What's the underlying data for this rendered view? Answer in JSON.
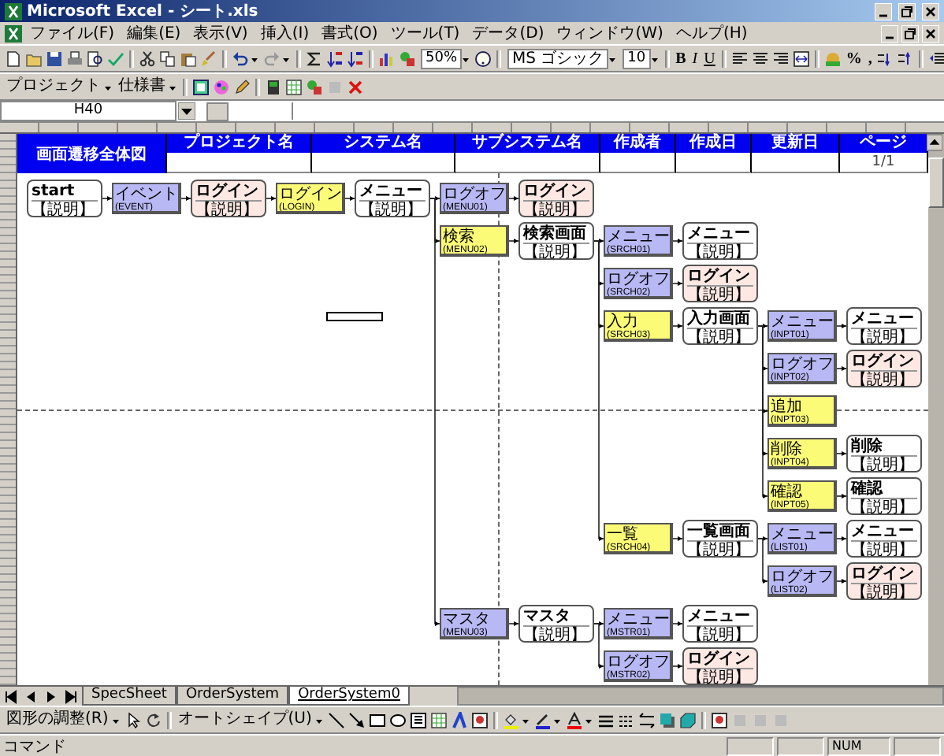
{
  "window": {
    "title": "Microsoft Excel - シート.xls"
  },
  "menu": [
    "ファイル(F)",
    "編集(E)",
    "表示(V)",
    "挿入(I)",
    "書式(O)",
    "ツール(T)",
    "データ(D)",
    "ウィンドウ(W)",
    "ヘルプ(H)"
  ],
  "standard_toolbar": {
    "zoom": "50%"
  },
  "formatting_toolbar": {
    "font": "MS ゴシック",
    "size": "10",
    "style_buttons": [
      "B",
      "I",
      "U"
    ],
    "number_buttons": [
      "%",
      ","
    ]
  },
  "custom_toolbar": {
    "menus": [
      "プロジェクト",
      "仕様書"
    ]
  },
  "formula_bar": {
    "name_box": "H40"
  },
  "sheet_header": {
    "title": "画面遷移全体図",
    "fields": [
      {
        "label": "プロジェクト名"
      },
      {
        "label": "システム名"
      },
      {
        "label": "サブシステム名"
      },
      {
        "label": "作成者"
      },
      {
        "label": "作成日"
      },
      {
        "label": "更新日"
      },
      {
        "label": "ページ",
        "value": "1/1"
      }
    ]
  },
  "flow": {
    "root": {
      "kind": "screen",
      "title": "start",
      "note": "【説明】",
      "children": [
        {
          "kind": "event",
          "label": "イベント",
          "code": "(EVENT)",
          "children": [
            {
              "kind": "login",
              "title": "ログイン",
              "note": "【説明】",
              "children": [
                {
                  "kind": "condition",
                  "label": "ログイン",
                  "code": "(LOGIN)",
                  "children": [
                    {
                      "kind": "screen",
                      "title": "メニュー",
                      "note": "【説明】",
                      "children": [
                        {
                          "kind": "event",
                          "label": "ログオフ",
                          "code": "(MENU01)",
                          "children": [
                            {
                              "kind": "login",
                              "title": "ログイン",
                              "note": "【説明】"
                            }
                          ]
                        },
                        {
                          "kind": "condition",
                          "label": "検索",
                          "code": "(MENU02)",
                          "children": [
                            {
                              "kind": "screen",
                              "title": "検索画面",
                              "note": "【説明】",
                              "children": [
                                {
                                  "kind": "event",
                                  "label": "メニュー",
                                  "code": "(SRCH01)",
                                  "children": [
                                    {
                                      "kind": "screen",
                                      "title": "メニュー",
                                      "note": "【説明】"
                                    }
                                  ]
                                },
                                {
                                  "kind": "event",
                                  "label": "ログオフ",
                                  "code": "(SRCH02)",
                                  "children": [
                                    {
                                      "kind": "login",
                                      "title": "ログイン",
                                      "note": "【説明】"
                                    }
                                  ]
                                },
                                {
                                  "kind": "condition",
                                  "label": "入力",
                                  "code": "(SRCH03)",
                                  "children": [
                                    {
                                      "kind": "screen",
                                      "title": "入力画面",
                                      "note": "【説明】",
                                      "children": [
                                        {
                                          "kind": "event",
                                          "label": "メニュー",
                                          "code": "(INPT01)",
                                          "children": [
                                            {
                                              "kind": "screen",
                                              "title": "メニュー",
                                              "note": "【説明】"
                                            }
                                          ]
                                        },
                                        {
                                          "kind": "event",
                                          "label": "ログオフ",
                                          "code": "(INPT02)",
                                          "children": [
                                            {
                                              "kind": "login",
                                              "title": "ログイン",
                                              "note": "【説明】"
                                            }
                                          ]
                                        },
                                        {
                                          "kind": "condition",
                                          "label": "追加",
                                          "code": "(INPT03)"
                                        },
                                        {
                                          "kind": "condition",
                                          "label": "削除",
                                          "code": "(INPT04)",
                                          "children": [
                                            {
                                              "kind": "screen",
                                              "title": "削除",
                                              "note": "【説明】"
                                            }
                                          ]
                                        },
                                        {
                                          "kind": "condition",
                                          "label": "確認",
                                          "code": "(INPT05)",
                                          "children": [
                                            {
                                              "kind": "screen",
                                              "title": "確認",
                                              "note": "【説明】"
                                            }
                                          ]
                                        }
                                      ]
                                    }
                                  ]
                                },
                                {
                                  "kind": "condition",
                                  "label": "一覧",
                                  "code": "(SRCH04)",
                                  "children": [
                                    {
                                      "kind": "screen",
                                      "title": "一覧画面",
                                      "note": "【説明】",
                                      "children": [
                                        {
                                          "kind": "event",
                                          "label": "メニュー",
                                          "code": "(LIST01)",
                                          "children": [
                                            {
                                              "kind": "screen",
                                              "title": "メニュー",
                                              "note": "【説明】"
                                            }
                                          ]
                                        },
                                        {
                                          "kind": "event",
                                          "label": "ログオフ",
                                          "code": "(LIST02)",
                                          "children": [
                                            {
                                              "kind": "login",
                                              "title": "ログイン",
                                              "note": "【説明】"
                                            }
                                          ]
                                        }
                                      ]
                                    }
                                  ]
                                }
                              ]
                            }
                          ]
                        },
                        {
                          "kind": "event",
                          "label": "マスタ",
                          "code": "(MENU03)",
                          "children": [
                            {
                              "kind": "screen",
                              "title": "マスタ",
                              "note": "【説明】",
                              "children": [
                                {
                                  "kind": "event",
                                  "label": "メニュー",
                                  "code": "(MSTR01)",
                                  "children": [
                                    {
                                      "kind": "screen",
                                      "title": "メニュー",
                                      "note": "【説明】"
                                    }
                                  ]
                                },
                                {
                                  "kind": "event",
                                  "label": "ログオフ",
                                  "code": "(MSTR02)",
                                  "children": [
                                    {
                                      "kind": "login",
                                      "title": "ログイン",
                                      "note": "【説明】"
                                    }
                                  ]
                                }
                              ]
                            }
                          ]
                        }
                      ]
                    }
                  ]
                }
              ]
            }
          ]
        }
      ]
    }
  },
  "sheet_tabs": [
    {
      "label": "SpecSheet",
      "selected": false
    },
    {
      "label": "OrderSystem",
      "selected": false
    },
    {
      "label": "OrderSystem0",
      "selected": true
    }
  ],
  "drawing_toolbar": {
    "menus": [
      "図形の調整(R)",
      "オートシェイプ(U)"
    ]
  },
  "status_bar": {
    "mode": "コマンド",
    "indicators": [
      "NUM"
    ]
  }
}
